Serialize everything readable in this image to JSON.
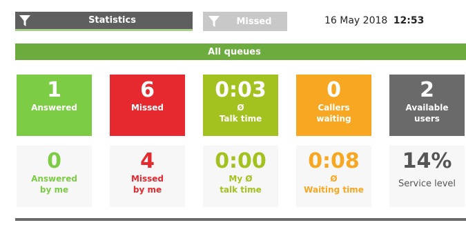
{
  "tabs": {
    "statistics_label": "Statistics",
    "missed_label": "Missed"
  },
  "datetime": {
    "date": "16 May 2018",
    "time": "12:53"
  },
  "queues_bar": {
    "label": "All queues"
  },
  "stats_row1": [
    {
      "value": "1",
      "line1": "Answered",
      "line2": "",
      "color": "#7ccd45"
    },
    {
      "value": "6",
      "line1": "Missed",
      "line2": "",
      "color": "#e5292f"
    },
    {
      "value": "0:03",
      "line1": "Ø",
      "line2": "Talk time",
      "color": "#a3c11f"
    },
    {
      "value": "0",
      "line1": "Callers",
      "line2": "waiting",
      "color": "#f7a721"
    },
    {
      "value": "2",
      "line1": "Available",
      "line2": "users",
      "color": "#6a6a6a"
    }
  ],
  "stats_row2": [
    {
      "value": "0",
      "line1": "Answered",
      "line2": "by me",
      "color": "#7ccd45"
    },
    {
      "value": "4",
      "line1": "Missed",
      "line2": "by me",
      "color": "#e5292f"
    },
    {
      "value": "0:00",
      "line1": "My Ø",
      "line2": "talk time",
      "color": "#a3c11f"
    },
    {
      "value": "0:08",
      "line1": "Ø",
      "line2": "Waiting time",
      "color": "#f7a721"
    },
    {
      "value": "14%",
      "line1": "Service level",
      "line2": "",
      "color": "#555555"
    }
  ],
  "icons": {
    "filter": "funnel-icon"
  }
}
